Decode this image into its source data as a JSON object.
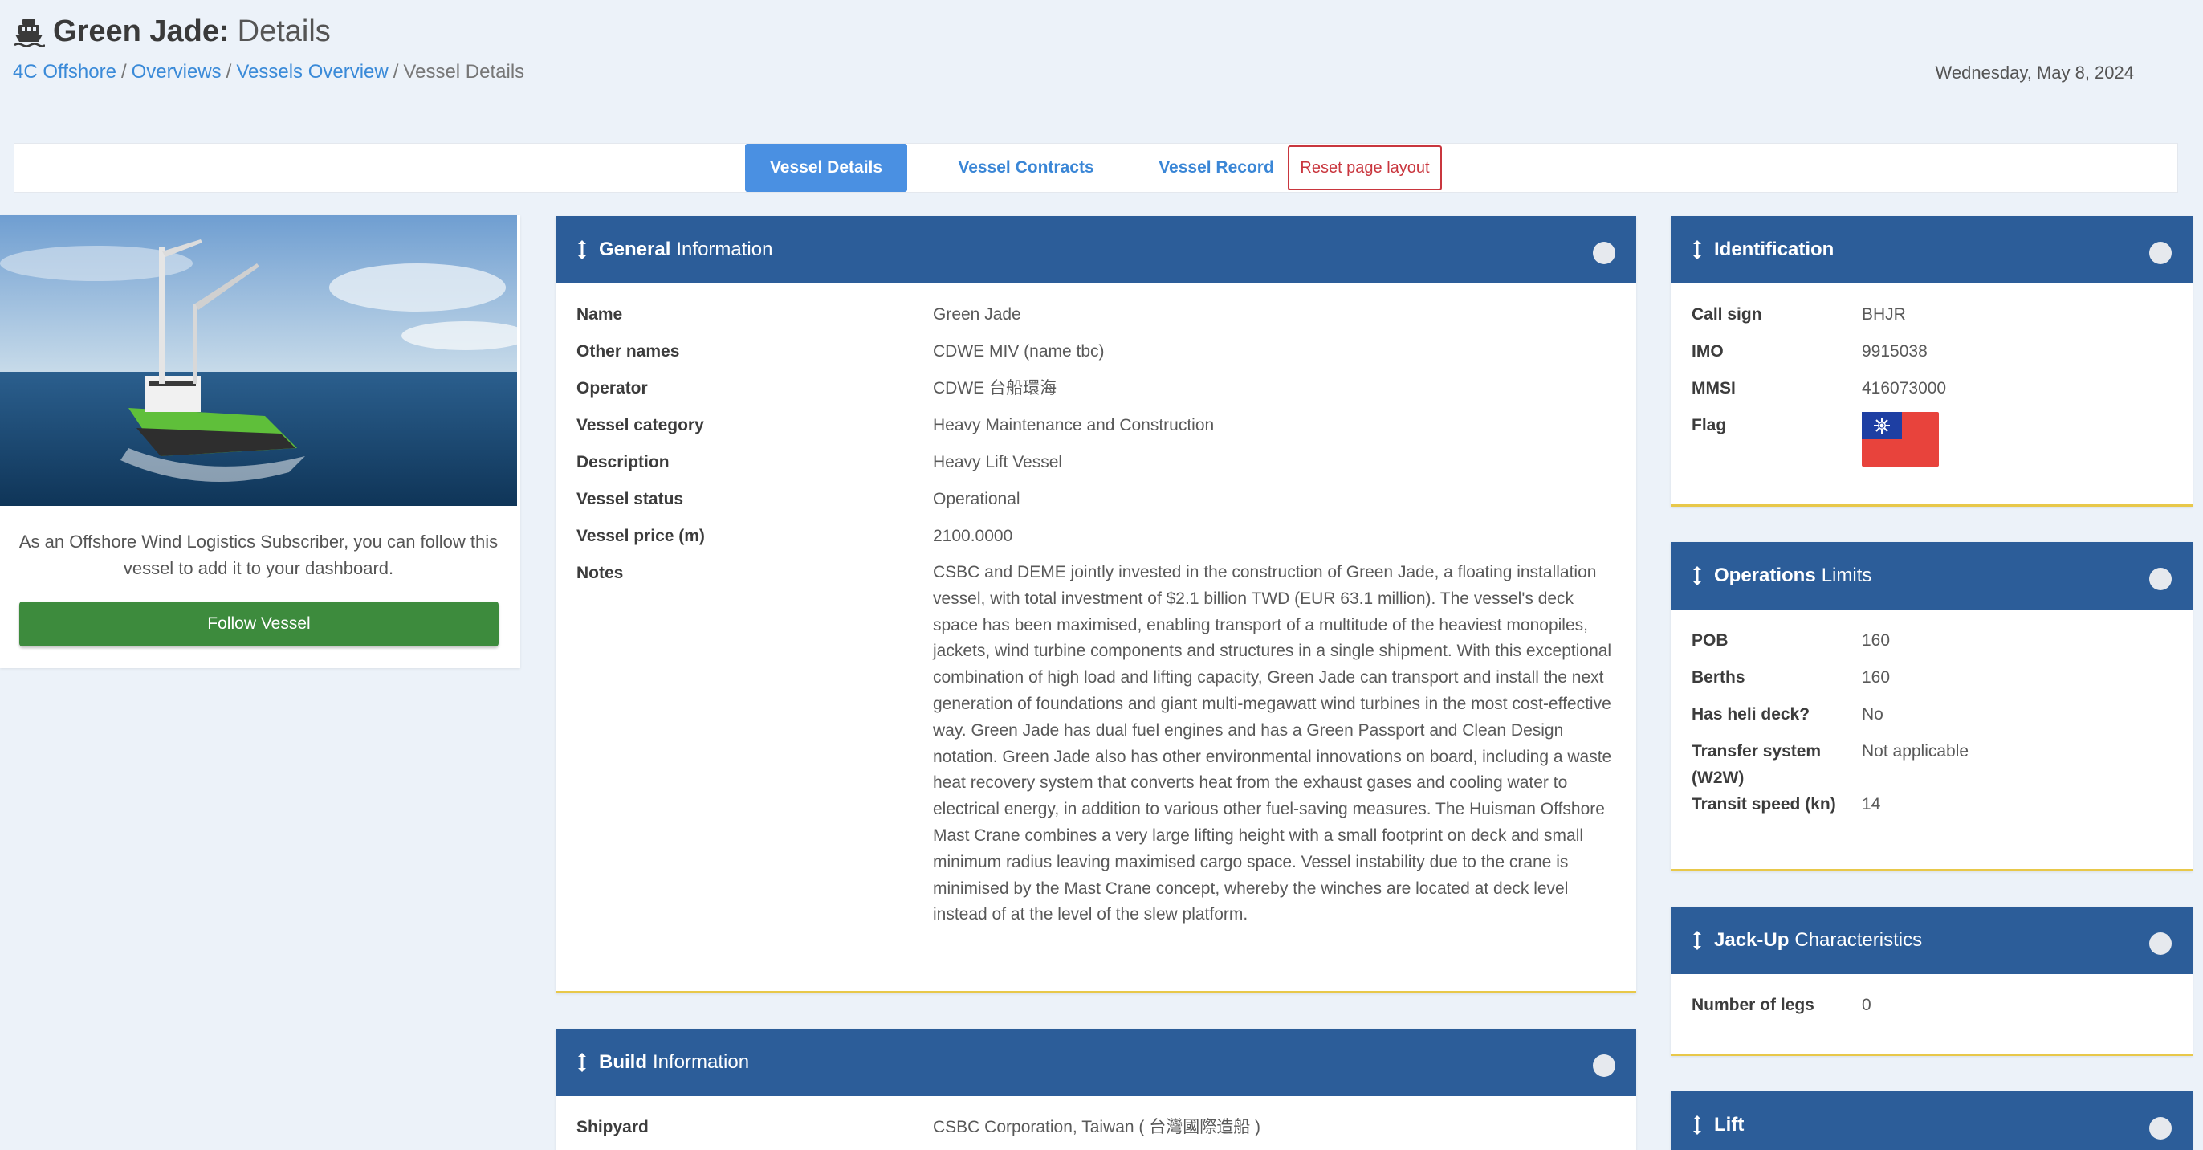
{
  "header": {
    "title_bold": "Green Jade:",
    "title_light": "Details",
    "date": "Wednesday, May 8, 2024"
  },
  "breadcrumb": {
    "items": [
      "4C Offshore",
      "Overviews",
      "Vessels Overview"
    ],
    "current": "Vessel Details",
    "separator": "/"
  },
  "tabs": {
    "vessel_details": "Vessel Details",
    "vessel_contracts": "Vessel Contracts",
    "vessel_record": "Vessel Record",
    "reset": "Reset page layout"
  },
  "follow": {
    "text": "As an Offshore Wind Logistics Subscriber, you can follow this vessel to add it to your dashboard.",
    "button": "Follow Vessel"
  },
  "general": {
    "title_bold": "General",
    "title_light": "Information",
    "rows": [
      {
        "label": "Name",
        "value": "Green Jade"
      },
      {
        "label": "Other names",
        "value": "CDWE MIV (name tbc)"
      },
      {
        "label": "Operator",
        "value": "CDWE 台船環海"
      },
      {
        "label": "Vessel category",
        "value": "Heavy Maintenance and Construction"
      },
      {
        "label": "Description",
        "value": "Heavy Lift Vessel"
      },
      {
        "label": "Vessel status",
        "value": "Operational"
      },
      {
        "label": "Vessel price (m)",
        "value": "2100.0000"
      }
    ],
    "notes_label": "Notes",
    "notes": "CSBC and DEME jointly invested in the construction of Green Jade, a floating installation vessel, with total investment of $2.1 billion TWD (EUR 63.1 million). The vessel's deck space has been maximised, enabling transport of a multitude of the heaviest monopiles, jackets, wind turbine components and structures in a single shipment. With this exceptional combination of high load and lifting capacity, Green Jade can transport and install the next generation of foundations and giant multi-megawatt wind turbines in the most cost-effective way.  Green Jade has dual fuel engines and has a Green Passport and Clean Design notation. Green Jade also has other environmental innovations on board, including a waste heat recovery system that converts heat from the exhaust gases and cooling water to electrical energy, in addition to various other fuel-saving measures. The Huisman Offshore Mast Crane combines a very large lifting height with a small footprint on deck and small minimum radius leaving maximised cargo space. Vessel instability due to the crane is minimised by the Mast Crane concept, whereby the winches are located at deck level instead of at the level of the slew platform."
  },
  "build": {
    "title_bold": "Build",
    "title_light": "Information",
    "rows": [
      {
        "label": "Shipyard",
        "value": "CSBC Corporation, Taiwan ( 台灣國際造船 )"
      }
    ]
  },
  "identification": {
    "title_bold": "Identification",
    "rows": [
      {
        "label": "Call sign",
        "value": "BHJR"
      },
      {
        "label": "IMO",
        "value": "9915038"
      },
      {
        "label": "MMSI",
        "value": "416073000"
      }
    ],
    "flag_label": "Flag",
    "flag_icon": "taiwan-flag",
    "flag_colors": {
      "red": "#e8433c",
      "blue": "#1e3fa3",
      "white": "#ffffff"
    }
  },
  "operations": {
    "title_bold": "Operations",
    "title_light": "Limits",
    "rows": [
      {
        "label": "POB",
        "value": "160"
      },
      {
        "label": "Berths",
        "value": "160"
      },
      {
        "label": "Has heli deck?",
        "value": "No"
      },
      {
        "label": "Transfer system (W2W)",
        "value": "Not applicable"
      },
      {
        "label": "Transit speed (kn)",
        "value": "14"
      }
    ]
  },
  "jackup": {
    "title_bold": "Jack-Up",
    "title_light": "Characteristics",
    "rows": [
      {
        "label": "Number of legs",
        "value": "0"
      }
    ]
  },
  "lift": {
    "title_bold": "Lift"
  },
  "colors": {
    "panel_header": "#2c5d99",
    "accent_blue": "#4a90e2",
    "follow_green": "#3d8b3d",
    "reset_red": "#c9363e",
    "panel_border": "#e8c84a"
  }
}
